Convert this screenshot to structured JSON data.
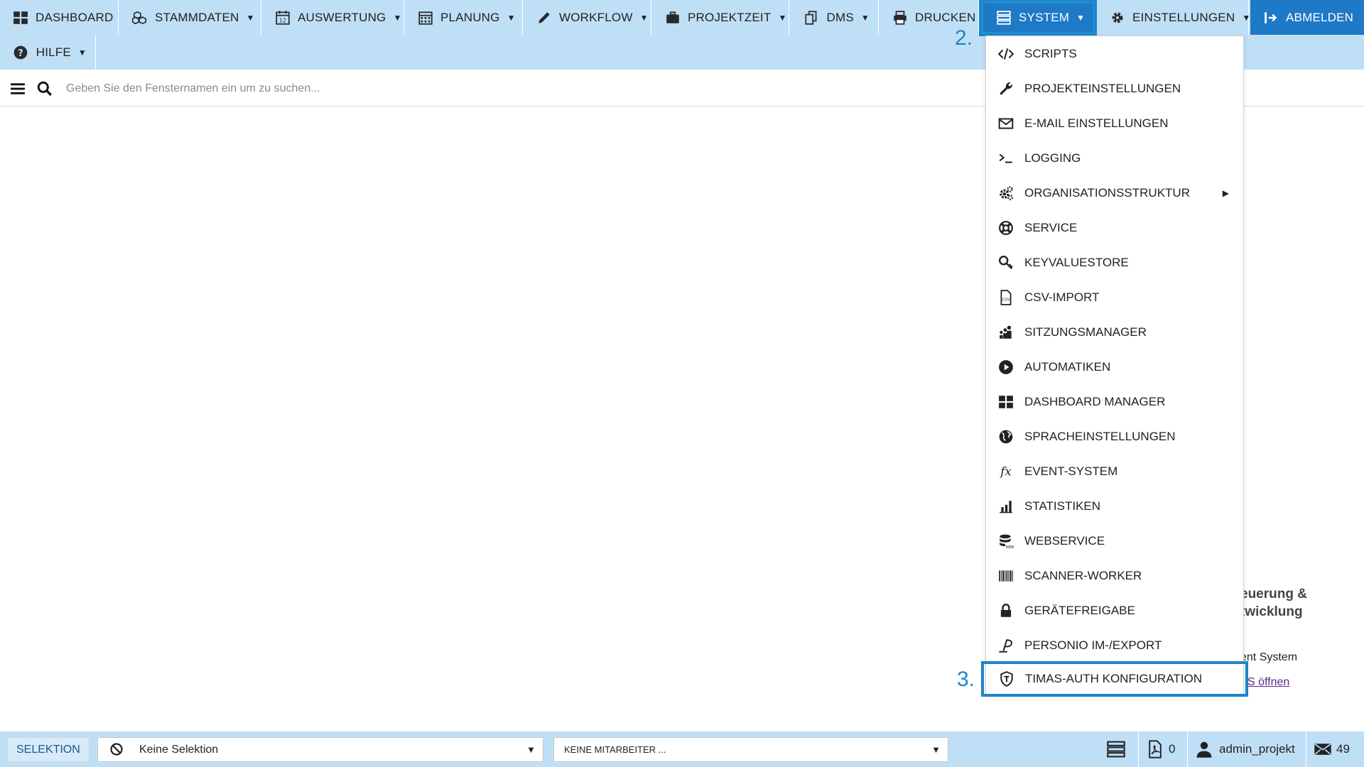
{
  "menu": {
    "items": [
      {
        "label": "DASHBOARD",
        "icon": "dashboard-grid-icon"
      },
      {
        "label": "STAMMDATEN",
        "icon": "cubes-icon"
      },
      {
        "label": "AUSWERTUNG",
        "icon": "calendar-12-icon"
      },
      {
        "label": "PLANUNG",
        "icon": "calendar-grid-icon"
      },
      {
        "label": "WORKFLOW",
        "icon": "pencil-icon"
      },
      {
        "label": "PROJEKTZEIT",
        "icon": "briefcase-icon"
      },
      {
        "label": "DMS",
        "icon": "documents-icon"
      },
      {
        "label": "DRUCKEN",
        "icon": "printer-icon"
      },
      {
        "label": "SYSTEM",
        "icon": "server-list-icon"
      },
      {
        "label": "EINSTELLUNGEN",
        "icon": "gear-icon"
      },
      {
        "label": "ABMELDEN",
        "icon": "logout-icon"
      },
      {
        "label": "HILFE",
        "icon": "help-circle-icon"
      }
    ]
  },
  "search": {
    "placeholder": "Geben Sie den Fensternamen ein um zu suchen..."
  },
  "steps": {
    "step2": "2.",
    "step3": "3."
  },
  "dropdown": {
    "items": [
      {
        "label": "SCRIPTS",
        "icon": "code-icon"
      },
      {
        "label": "PROJEKTEINSTELLUNGEN",
        "icon": "wrench-icon"
      },
      {
        "label": "E-MAIL EINSTELLUNGEN",
        "icon": "envelope-icon"
      },
      {
        "label": "LOGGING",
        "icon": "terminal-icon"
      },
      {
        "label": "ORGANISATIONSSTRUKTUR",
        "icon": "cogs-icon"
      },
      {
        "label": "SERVICE",
        "icon": "lifebuoy-icon"
      },
      {
        "label": "KEYVALUESTORE",
        "icon": "key-search-icon"
      },
      {
        "label": "CSV-IMPORT",
        "icon": "csv-file-icon"
      },
      {
        "label": "SITZUNGSMANAGER",
        "icon": "users-group-icon"
      },
      {
        "label": "AUTOMATIKEN",
        "icon": "play-circle-icon"
      },
      {
        "label": "DASHBOARD MANAGER",
        "icon": "dashboard-grid-icon"
      },
      {
        "label": "SPRACHEINSTELLUNGEN",
        "icon": "globe-icon"
      },
      {
        "label": "EVENT-SYSTEM",
        "icon": "function-icon"
      },
      {
        "label": "STATISTIKEN",
        "icon": "bar-chart-icon"
      },
      {
        "label": "WEBSERVICE",
        "icon": "database-web-icon"
      },
      {
        "label": "SCANNER-WORKER",
        "icon": "barcode-icon"
      },
      {
        "label": "GERÄTEFREIGABE",
        "icon": "lock-icon"
      },
      {
        "label": "PERSONIO IM-/EXPORT",
        "icon": "personio-icon"
      },
      {
        "label": "TIMAS-AUTH KONFIGURATION",
        "icon": "shield-icon"
      }
    ]
  },
  "background": {
    "line1": "euerung  &",
    "line2": "twicklung",
    "line3": "ent System",
    "link": "S öffnen"
  },
  "statusbar": {
    "selektion": "SELEKTION",
    "selection_value": "Keine Selektion",
    "employee_value": "KEINE MITARBEITER ...",
    "pdf_count": "0",
    "user": "admin_projekt",
    "mail_count": "49"
  },
  "colors": {
    "menubar": "#bfdff7",
    "accent": "#1e79c7",
    "highlight": "#1b86c9"
  }
}
